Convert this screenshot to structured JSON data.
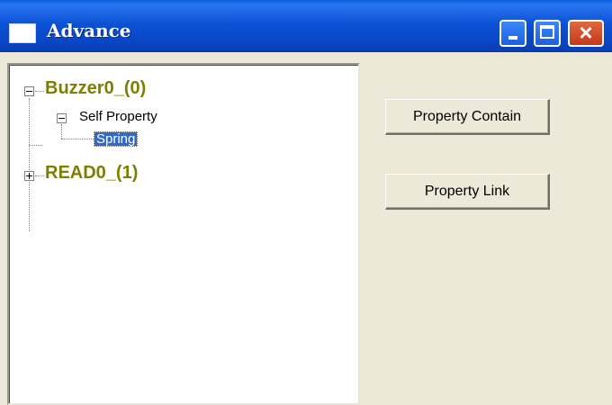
{
  "window": {
    "title": "Advance",
    "controls": {
      "minimize": "minimize-icon",
      "maximize": "maximize-icon",
      "close": "close-icon"
    },
    "colors": {
      "titlebar": "#0a48c8",
      "face": "#ece9d8",
      "selection": "#316ac5",
      "root_node": "#7e7e00"
    }
  },
  "tree": {
    "nodes": [
      {
        "label": "Buzzer0_(0)",
        "expanded": true,
        "children": [
          {
            "label": "Self Property",
            "expanded": true,
            "children": [
              {
                "label": "Spring",
                "selected": true
              }
            ]
          }
        ]
      },
      {
        "label": "READ0_(1)",
        "expanded": false,
        "children": []
      }
    ]
  },
  "buttons": {
    "property_contain": "Property Contain",
    "property_link": "Property Link"
  }
}
